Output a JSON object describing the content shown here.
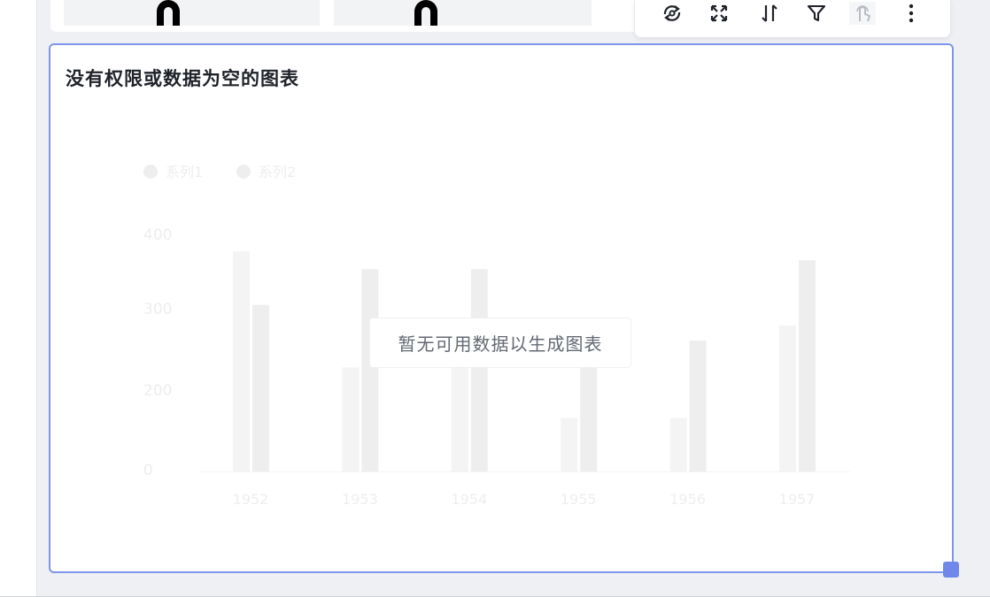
{
  "toolbar": {
    "items": [
      {
        "icon": "refresh-icon"
      },
      {
        "icon": "fullscreen-icon"
      },
      {
        "icon": "sort-icon"
      },
      {
        "icon": "filter-icon"
      },
      {
        "icon": "drill-icon",
        "disabled": true
      },
      {
        "icon": "more-icon"
      }
    ]
  },
  "card": {
    "title": "没有权限或数据为空的图表",
    "empty_message": "暂无可用数据以生成图表"
  },
  "colors": {
    "accent": "#7f95ec",
    "handle": "#6f86ea",
    "placeholder_light": "#f4f4f4",
    "placeholder_dark": "#eeeeee"
  },
  "chart_data": {
    "type": "bar",
    "categories": [
      "1952",
      "1953",
      "1954",
      "1955",
      "1956",
      "1957"
    ],
    "series": [
      {
        "name": "系列1",
        "values": [
          370,
          175,
          175,
          90,
          90,
          245
        ]
      },
      {
        "name": "系列2",
        "values": [
          280,
          340,
          340,
          220,
          220,
          355
        ]
      }
    ],
    "y_ticks": [
      "0",
      "200",
      "300",
      "400"
    ],
    "legend_position": "top-left",
    "grid": false
  }
}
